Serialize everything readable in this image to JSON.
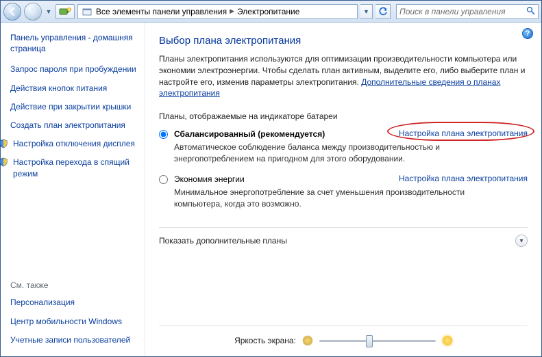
{
  "nav": {
    "breadcrumb_root": "Все элементы панели управления",
    "breadcrumb_current": "Электропитание",
    "search_placeholder": "Поиск в панели управления"
  },
  "sidebar": {
    "home": "Панель управления - домашняя страница",
    "links": [
      "Запрос пароля при пробуждении",
      "Действия кнопок питания",
      "Действие при закрытии крышки",
      "Создать план электропитания",
      "Настройка отключения дисплея",
      "Настройка перехода в спящий режим"
    ],
    "see_also_label": "См. также",
    "see_also": [
      "Персонализация",
      "Центр мобильности Windows",
      "Учетные записи пользователей"
    ]
  },
  "main": {
    "title": "Выбор плана электропитания",
    "intro_text": "Планы электропитания используются для оптимизации производительности компьютера или экономии электроэнергии. Чтобы сделать план активным, выделите его, либо выберите план и настройте его, изменив параметры электропитания. ",
    "intro_link": "Дополнительные сведения о планах электропитания",
    "battery_label": "Планы, отображаемые на индикаторе батареи",
    "plans": [
      {
        "name": "Сбалансированный (рекомендуется)",
        "config": "Настройка плана электропитания",
        "desc": "Автоматическое соблюдение баланса между производительностью и энергопотреблением на пригодном для этого оборудовании."
      },
      {
        "name": "Экономия энергии",
        "config": "Настройка плана электропитания",
        "desc": "Минимальное энергопотребление за счет уменьшения производительности компьютера, когда это возможно."
      }
    ],
    "expander": "Показать дополнительные планы",
    "brightness_label": "Яркость экрана:"
  }
}
